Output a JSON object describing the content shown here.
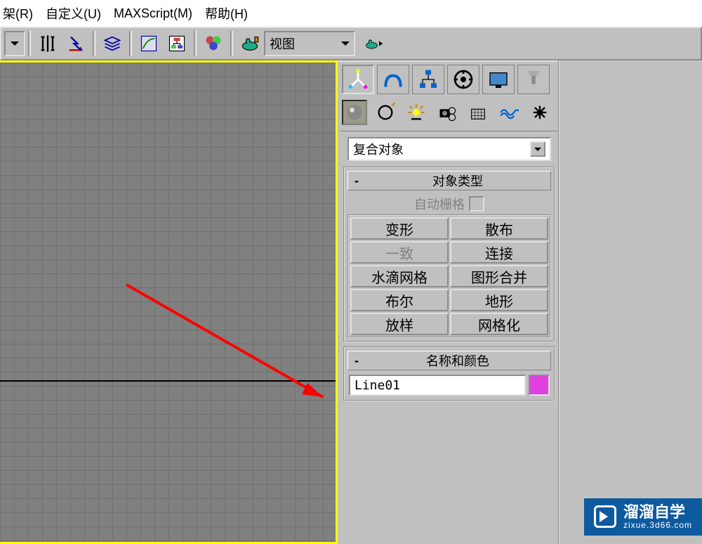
{
  "menu": {
    "reactor": "架(R)",
    "customize": "自定义(U)",
    "maxscript": "MAXScript(M)",
    "help": "帮助(H)"
  },
  "toolbar": {
    "view_label": "视图"
  },
  "create_panel": {
    "category_dropdown": "复合对象",
    "rollout_object_type": {
      "title": "对象类型",
      "autogrid_label": "自动栅格",
      "buttons": {
        "morph": "变形",
        "scatter": "散布",
        "conform": "一致",
        "connect": "连接",
        "blobmesh": "水滴网格",
        "shapemerge": "图形合并",
        "boolean": "布尔",
        "terrain": "地形",
        "loft": "放样",
        "mesher": "网格化"
      }
    },
    "rollout_name_color": {
      "title": "名称和颜色",
      "object_name": "Line01"
    }
  },
  "rollout_collapse": "-",
  "watermark": {
    "title": "溜溜自学",
    "domain": "zixue.3d66.com"
  }
}
